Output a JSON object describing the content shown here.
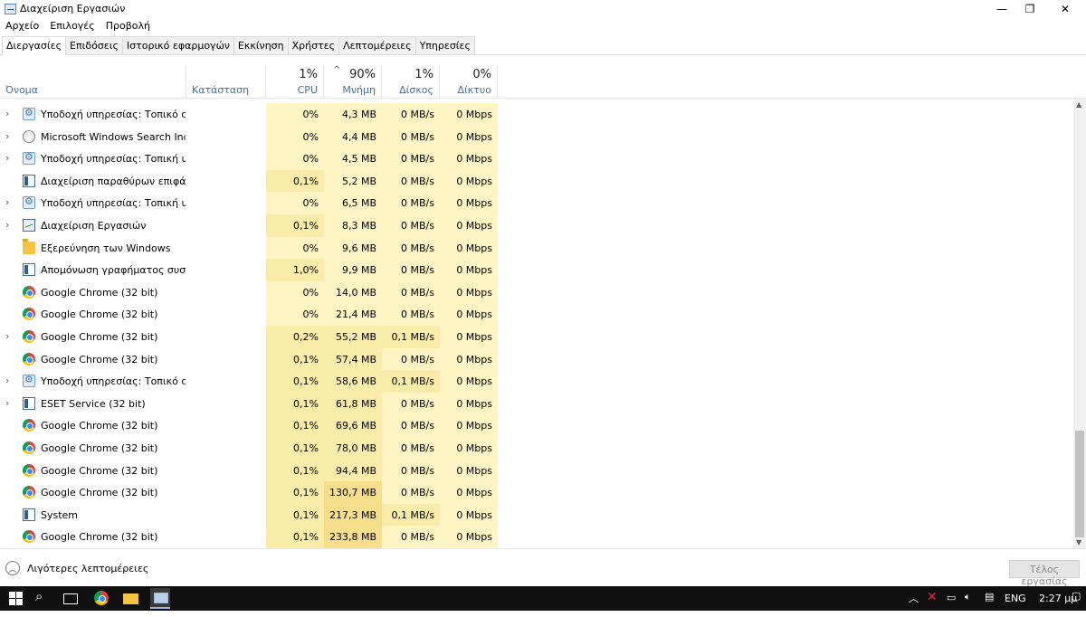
{
  "window": {
    "title": "Διαχείριση Εργασιών",
    "controls": {
      "minimize": "—",
      "restore": "❐",
      "close": "✕"
    }
  },
  "menu": [
    "Αρχείο",
    "Επιλογές",
    "Προβολή"
  ],
  "tabs": [
    "Διεργασίες",
    "Επιδόσεις",
    "Ιστορικό εφαρμογών",
    "Εκκίνηση",
    "Χρήστες",
    "Λεπτομέρειες",
    "Υπηρεσίες"
  ],
  "active_tab": "Διεργασίες",
  "columns": {
    "name": {
      "label": "Όνομα"
    },
    "status": {
      "label": "Κατάσταση"
    },
    "cpu": {
      "pct": "1%",
      "label": "CPU"
    },
    "memory": {
      "pct": "90%",
      "label": "Μνήμη",
      "sort_indicator": "^"
    },
    "disk": {
      "pct": "1%",
      "label": "Δίσκος"
    },
    "network": {
      "pct": "0%",
      "label": "Δίκτυο"
    }
  },
  "processes": [
    {
      "name": "Υποδοχή υπηρεσίας: Τοπικό σ...",
      "icon": "gear-icon",
      "expandable": true,
      "cpu": "0%",
      "mem": "4,3 MB",
      "disk": "0 MB/s",
      "net": "0 Mbps"
    },
    {
      "name": "Microsoft Windows Search Inde...",
      "icon": "search-indexer-icon",
      "expandable": true,
      "cpu": "0%",
      "mem": "4,4 MB",
      "disk": "0 MB/s",
      "net": "0 Mbps"
    },
    {
      "name": "Υποδοχή υπηρεσίας: Τοπική υ...",
      "icon": "gear-icon",
      "expandable": true,
      "cpu": "0%",
      "mem": "4,5 MB",
      "disk": "0 MB/s",
      "net": "0 Mbps"
    },
    {
      "name": "Διαχείριση παραθύρων επιφάν...",
      "icon": "window-icon",
      "expandable": false,
      "cpu": "0,1%",
      "mem": "5,2 MB",
      "disk": "0 MB/s",
      "net": "0 Mbps"
    },
    {
      "name": "Υποδοχή υπηρεσίας: Τοπική υ...",
      "icon": "gear-icon",
      "expandable": true,
      "cpu": "0%",
      "mem": "6,5 MB",
      "disk": "0 MB/s",
      "net": "0 Mbps"
    },
    {
      "name": "Διαχείριση Εργασιών",
      "icon": "task-manager-icon",
      "expandable": true,
      "cpu": "0,1%",
      "mem": "8,3 MB",
      "disk": "0 MB/s",
      "net": "0 Mbps"
    },
    {
      "name": "Εξερεύνηση των Windows",
      "icon": "folder-icon",
      "expandable": false,
      "cpu": "0%",
      "mem": "9,6 MB",
      "disk": "0 MB/s",
      "net": "0 Mbps"
    },
    {
      "name": "Απομόνωση γραφήματος συσ...",
      "icon": "window-icon",
      "expandable": false,
      "cpu": "1,0%",
      "mem": "9,9 MB",
      "disk": "0 MB/s",
      "net": "0 Mbps"
    },
    {
      "name": "Google Chrome (32 bit)",
      "icon": "chrome-icon",
      "expandable": false,
      "cpu": "0%",
      "mem": "14,0 MB",
      "disk": "0 MB/s",
      "net": "0 Mbps"
    },
    {
      "name": "Google Chrome (32 bit)",
      "icon": "chrome-icon",
      "expandable": false,
      "cpu": "0%",
      "mem": "21,4 MB",
      "disk": "0 MB/s",
      "net": "0 Mbps"
    },
    {
      "name": "Google Chrome (32 bit)",
      "icon": "chrome-icon",
      "expandable": true,
      "cpu": "0,2%",
      "mem": "55,2 MB",
      "disk": "0,1 MB/s",
      "net": "0 Mbps"
    },
    {
      "name": "Google Chrome (32 bit)",
      "icon": "chrome-icon",
      "expandable": false,
      "cpu": "0,1%",
      "mem": "57,4 MB",
      "disk": "0 MB/s",
      "net": "0 Mbps"
    },
    {
      "name": "Υποδοχή υπηρεσίας: Τοπικό σ...",
      "icon": "gear-icon",
      "expandable": true,
      "cpu": "0,1%",
      "mem": "58,6 MB",
      "disk": "0,1 MB/s",
      "net": "0 Mbps"
    },
    {
      "name": "ESET Service (32 bit)",
      "icon": "window-icon",
      "expandable": true,
      "cpu": "0,1%",
      "mem": "61,8 MB",
      "disk": "0 MB/s",
      "net": "0 Mbps"
    },
    {
      "name": "Google Chrome (32 bit)",
      "icon": "chrome-icon",
      "expandable": false,
      "cpu": "0,1%",
      "mem": "69,6 MB",
      "disk": "0 MB/s",
      "net": "0 Mbps"
    },
    {
      "name": "Google Chrome (32 bit)",
      "icon": "chrome-icon",
      "expandable": false,
      "cpu": "0,1%",
      "mem": "78,0 MB",
      "disk": "0 MB/s",
      "net": "0 Mbps"
    },
    {
      "name": "Google Chrome (32 bit)",
      "icon": "chrome-icon",
      "expandable": false,
      "cpu": "0,1%",
      "mem": "94,4 MB",
      "disk": "0 MB/s",
      "net": "0 Mbps"
    },
    {
      "name": "Google Chrome (32 bit)",
      "icon": "chrome-icon",
      "expandable": false,
      "cpu": "0,1%",
      "mem": "130,7 MB",
      "disk": "0 MB/s",
      "net": "0 Mbps"
    },
    {
      "name": "System",
      "icon": "window-icon",
      "expandable": false,
      "cpu": "0,1%",
      "mem": "217,3 MB",
      "disk": "0,1 MB/s",
      "net": "0 Mbps"
    },
    {
      "name": "Google Chrome (32 bit)",
      "icon": "chrome-icon",
      "expandable": false,
      "cpu": "0,1%",
      "mem": "233,8 MB",
      "disk": "0 MB/s",
      "net": "0 Mbps"
    }
  ],
  "footer": {
    "fewer_details": "Λιγότερες λεπτομέρειες",
    "end_task": "Τέλος εργασίας"
  },
  "taskbar": {
    "language": "ENG",
    "time": "2:27 μμ"
  },
  "colors": {
    "cell_light": "#fff4c4",
    "cell_mid": "#f9eca8",
    "cell_strong": "#f6de8b",
    "header_label": "#4b6e98"
  }
}
